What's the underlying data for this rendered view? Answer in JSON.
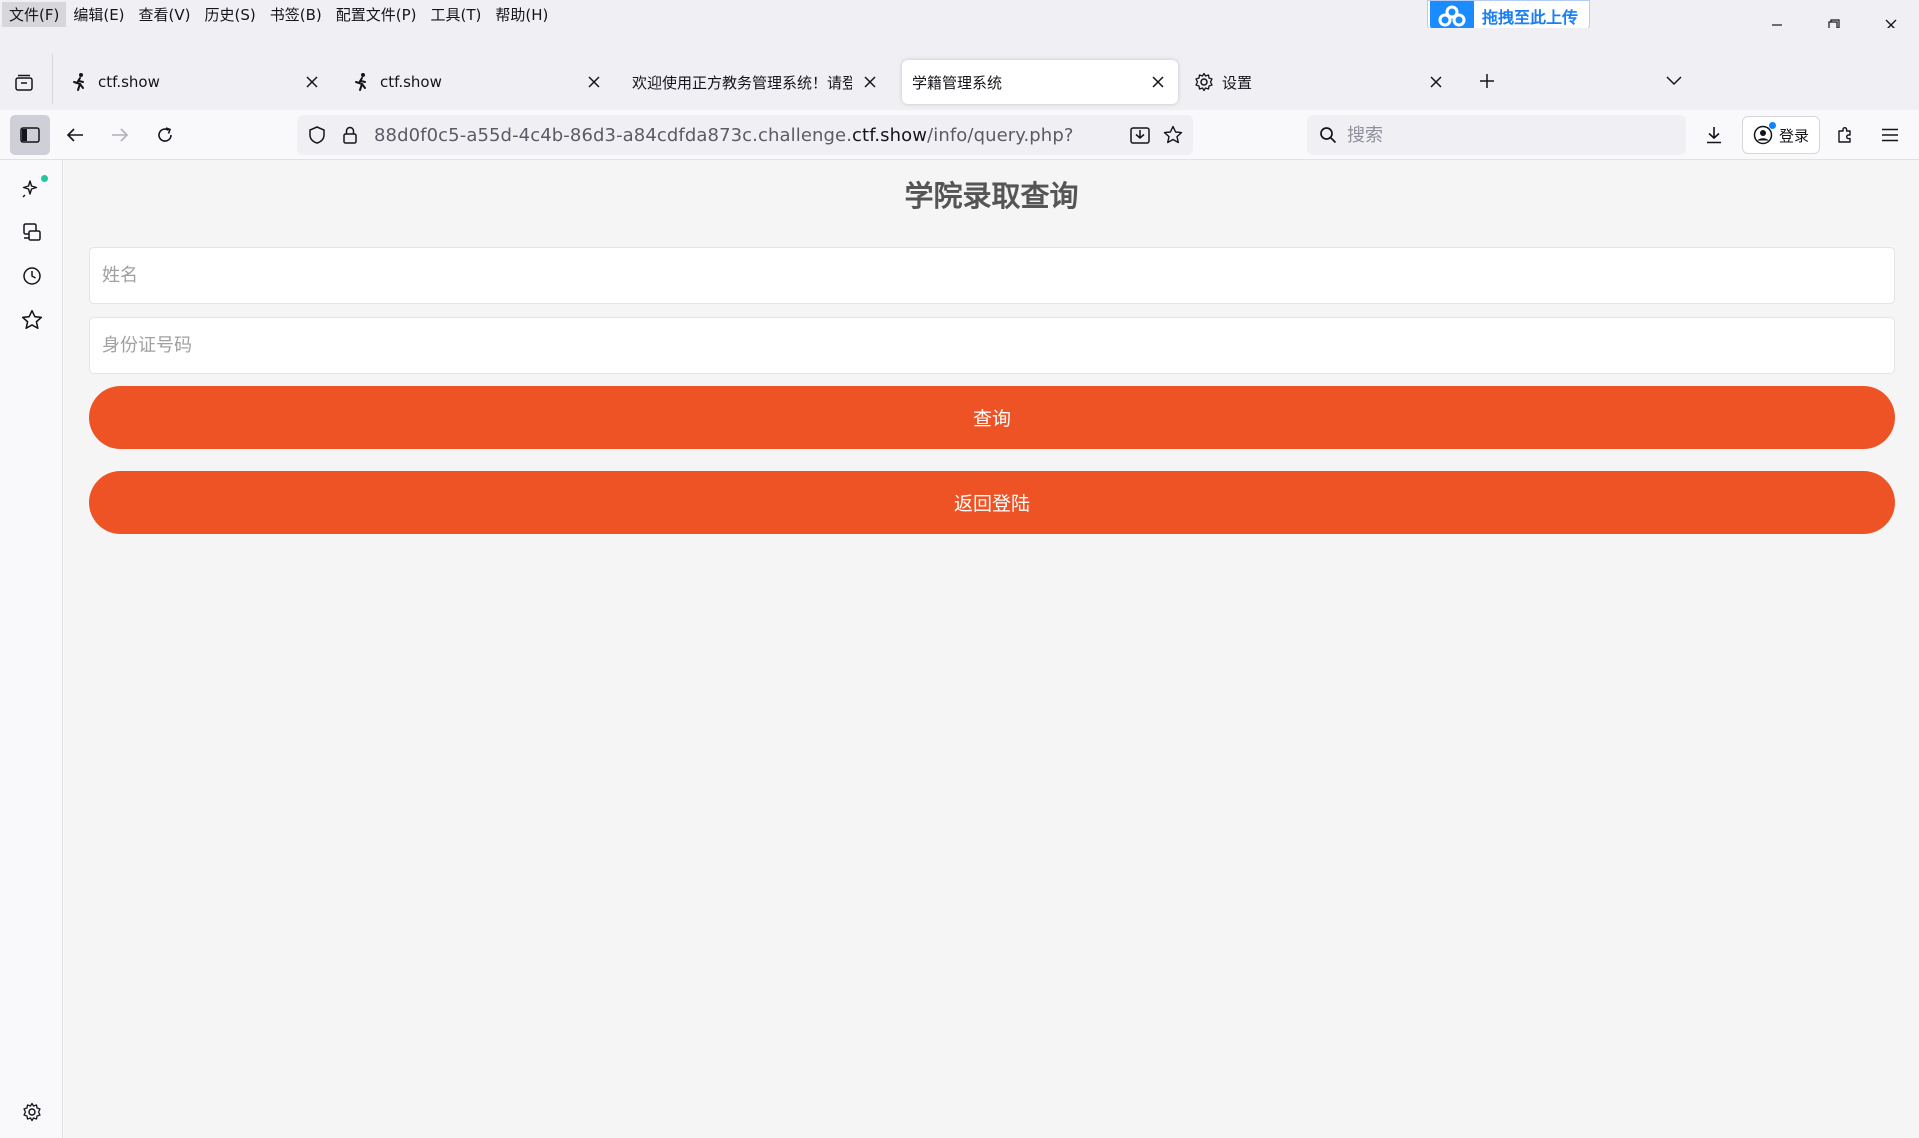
{
  "menu": {
    "items": [
      "文件(F)",
      "编辑(E)",
      "查看(V)",
      "历史(S)",
      "书签(B)",
      "配置文件(P)",
      "工具(T)",
      "帮助(H)"
    ]
  },
  "baidu_badge": {
    "label": "拖拽至此上传",
    "icon": "cloud-upload-icon"
  },
  "tabs": [
    {
      "title": "ctf.show",
      "icon": "runner-icon",
      "selected": false
    },
    {
      "title": "ctf.show",
      "icon": "runner-icon",
      "selected": false
    },
    {
      "title": "欢迎使用正方教务管理系统！请登录",
      "icon": "",
      "selected": false
    },
    {
      "title": "学籍管理系统",
      "icon": "",
      "selected": true
    },
    {
      "title": "设置",
      "icon": "gear-icon",
      "selected": false
    }
  ],
  "urlbar": {
    "prefix": "88d0f0c5-a55d-4c4b-86d3-a84cdfda873c.challenge.",
    "host": "ctf.show",
    "path": "/info/query.php?"
  },
  "search": {
    "placeholder": "搜索"
  },
  "account": {
    "login_label": "登录"
  },
  "page": {
    "title": "学院录取查询",
    "name_placeholder": "姓名",
    "id_placeholder": "身份证号码",
    "query_button": "查询",
    "back_button": "返回登陆"
  },
  "colors": {
    "button": "#ee5325",
    "page_bg": "#f5f5f5",
    "title": "#555555",
    "accent_dot": "#2ac3a2"
  }
}
